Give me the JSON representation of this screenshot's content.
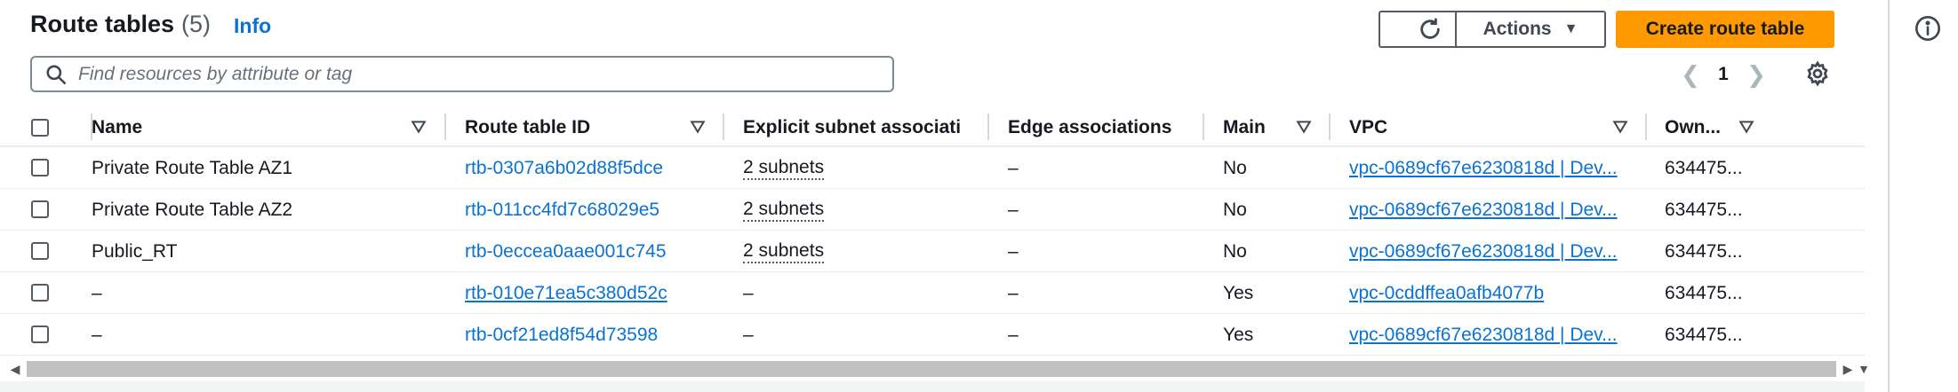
{
  "header": {
    "title": "Route tables",
    "count": "(5)",
    "info_link": "Info"
  },
  "toolbar": {
    "refresh_icon": "refresh-icon",
    "actions_label": "Actions",
    "create_label": "Create route table",
    "primary_color": "#ff9900"
  },
  "search": {
    "placeholder": "Find resources by attribute or tag",
    "value": ""
  },
  "pagination": {
    "current_page": "1"
  },
  "columns": [
    {
      "label": "Name"
    },
    {
      "label": "Route table ID"
    },
    {
      "label": "Explicit subnet associati..."
    },
    {
      "label": "Edge associations"
    },
    {
      "label": "Main"
    },
    {
      "label": "VPC"
    },
    {
      "label": "Own..."
    }
  ],
  "rows": [
    {
      "name": "Private Route Table AZ1",
      "id": "rtb-0307a6b02d88f5dce",
      "subnets": "2 subnets",
      "edge": "–",
      "main": "No",
      "vpc": "vpc-0689cf67e6230818d | Dev...",
      "owner": "634475..."
    },
    {
      "name": "Private Route Table AZ2",
      "id": "rtb-011cc4fd7c68029e5",
      "subnets": "2 subnets",
      "edge": "–",
      "main": "No",
      "vpc": "vpc-0689cf67e6230818d | Dev...",
      "owner": "634475..."
    },
    {
      "name": "Public_RT",
      "id": "rtb-0eccea0aae001c745",
      "subnets": "2 subnets",
      "edge": "–",
      "main": "No",
      "vpc": "vpc-0689cf67e6230818d | Dev...",
      "owner": "634475..."
    },
    {
      "name": "–",
      "id": "rtb-010e71ea5c380d52c",
      "subnets": "–",
      "edge": "–",
      "main": "Yes",
      "vpc": "vpc-0cddffea0afb4077b",
      "owner": "634475..."
    },
    {
      "name": "–",
      "id": "rtb-0cf21ed8f54d73598",
      "subnets": "–",
      "edge": "–",
      "main": "Yes",
      "vpc": "vpc-0689cf67e6230818d | Dev...",
      "owner": "634475..."
    }
  ]
}
